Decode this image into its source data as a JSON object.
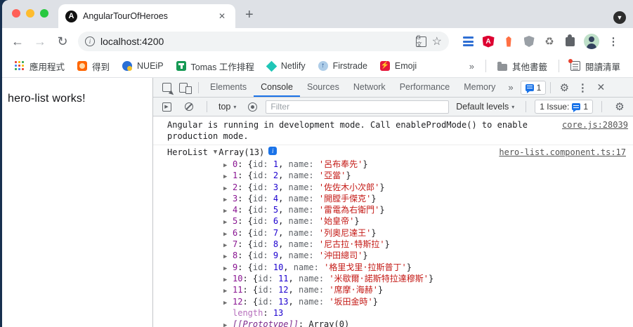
{
  "glyphs": {
    "close": "✕",
    "plus": "+",
    "chevron_more": "»",
    "back": "←",
    "forward": "→",
    "reload": "↻",
    "caret_down": "▾",
    "tri_right": "▶",
    "tri_down": "▼",
    "star": "☆",
    "kebab": "⋮",
    "gear": "⚙",
    "recycle": "♻",
    "info": "i",
    "overview_caret": "▼",
    "translate": "G文",
    "drawer_play": "▶"
  },
  "window": {
    "tab": {
      "title": "AngularTourOfHeroes",
      "favicon_letter": "A"
    },
    "toolbar": {
      "url": "localhost:4200"
    },
    "bookmarks": {
      "items": [
        {
          "label": "應用程式",
          "icon": "i-apps"
        },
        {
          "label": "得到",
          "icon": "i-dedao"
        },
        {
          "label": "NUEiP",
          "icon": "i-nueip"
        },
        {
          "label": "Tomas 工作排程",
          "icon": "i-tomas"
        },
        {
          "label": "Netlify",
          "icon": "i-netlify"
        },
        {
          "label": "Firstrade",
          "icon": "i-firstrade"
        },
        {
          "label": "Emoji",
          "icon": "i-emoji"
        }
      ],
      "other_bookmarks": "其他書籤",
      "reading_list": "閱讀清單"
    }
  },
  "page": {
    "text": "hero-list works!"
  },
  "devtools": {
    "tabs": [
      "Elements",
      "Console",
      "Sources",
      "Network",
      "Performance",
      "Memory"
    ],
    "active_tab": "Console",
    "message_count": "1",
    "console_toolbar": {
      "context": "top",
      "filter_placeholder": "Filter",
      "levels": "Default levels",
      "issues_label": "1 Issue:",
      "issues_count": "1"
    },
    "console": {
      "info_message": {
        "text": "Angular is running in development mode. Call enableProdMode() to enable production mode.",
        "source": "core.js:28039"
      },
      "herolist": {
        "label": "HeroList",
        "value": "Array(13)",
        "source": "hero-list.component.ts:17"
      },
      "array_items": [
        {
          "index": "0",
          "id": "1",
          "name": "'呂布奉先'"
        },
        {
          "index": "1",
          "id": "2",
          "name": "'亞當'"
        },
        {
          "index": "2",
          "id": "3",
          "name": "'佐佐木小次郎'"
        },
        {
          "index": "3",
          "id": "4",
          "name": "'開膛手傑克'"
        },
        {
          "index": "4",
          "id": "5",
          "name": "'雷電為右衛門'"
        },
        {
          "index": "5",
          "id": "6",
          "name": "'始皇帝'"
        },
        {
          "index": "6",
          "id": "7",
          "name": "'列奧尼達王'"
        },
        {
          "index": "7",
          "id": "8",
          "name": "'尼古拉·特斯拉'"
        },
        {
          "index": "8",
          "id": "9",
          "name": "'沖田總司'"
        },
        {
          "index": "9",
          "id": "10",
          "name": "'格里戈里·拉斯普丁'"
        },
        {
          "index": "10",
          "id": "11",
          "name": "'米歇爾·諾斯特拉達穆斯'"
        },
        {
          "index": "11",
          "id": "12",
          "name": "'席摩·海赫'"
        },
        {
          "index": "12",
          "id": "13",
          "name": "'坂田金時'"
        }
      ],
      "length_row": {
        "key": "length",
        "value": "13"
      },
      "prototype_row": {
        "key": "[[Prototype]]",
        "value": "Array(0)"
      }
    }
  },
  "colors": {
    "accent_blue": "#1a73e8",
    "key_purple": "#881391",
    "number_blue": "#1c00cf",
    "string_red": "#c41a16",
    "preview_key_gray": "#5f6368",
    "traffic_red": "#ff5f57",
    "traffic_yellow": "#febc2e",
    "traffic_green": "#28c840"
  }
}
